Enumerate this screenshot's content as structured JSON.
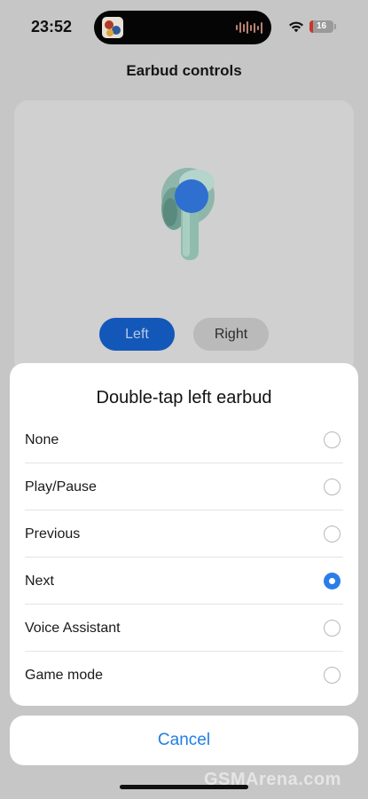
{
  "status_bar": {
    "time": "23:52",
    "battery": "16",
    "battery_color": "#c9352f"
  },
  "page": {
    "title": "Earbud controls"
  },
  "segment": {
    "left_label": "Left",
    "right_label": "Right",
    "selected": "Left"
  },
  "sheet": {
    "title": "Double-tap left earbud",
    "options": [
      {
        "label": "None",
        "selected": false
      },
      {
        "label": "Play/Pause",
        "selected": false
      },
      {
        "label": "Previous",
        "selected": false
      },
      {
        "label": "Next",
        "selected": true
      },
      {
        "label": "Voice Assistant",
        "selected": false
      },
      {
        "label": "Game mode",
        "selected": false
      }
    ],
    "cancel_label": "Cancel"
  },
  "watermark": "GSMArena.com",
  "colors": {
    "accent": "#1f7fe5",
    "segment_selected": "#1358b9",
    "radio_checked": "#2b7de9"
  }
}
